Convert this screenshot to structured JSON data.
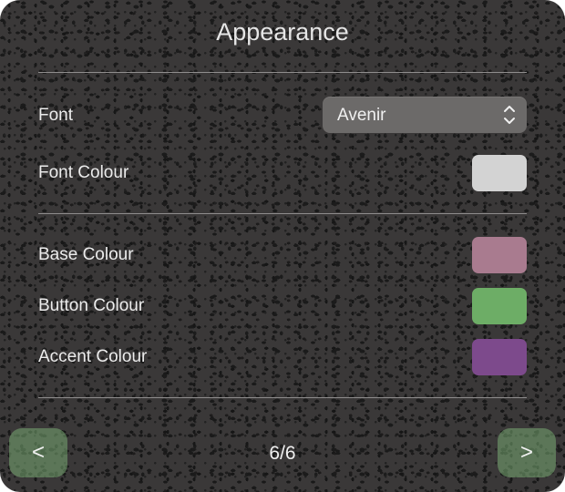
{
  "window": {
    "title": "Appearance"
  },
  "font": {
    "label": "Font",
    "selected": "Avenir"
  },
  "font_colour": {
    "label": "Font Colour",
    "color": "#d3d3d3"
  },
  "base_colour": {
    "label": "Base Colour",
    "color": "#a97b8f"
  },
  "button_colour": {
    "label": "Button Colour",
    "color": "#6dad66"
  },
  "accent_colour": {
    "label": "Accent Colour",
    "color": "#7d4a8c"
  },
  "navigation": {
    "prev_label": "<",
    "next_label": ">",
    "page_text": "6/6"
  },
  "icons": {
    "select_chevrons": "chevron-up-down-icon"
  }
}
